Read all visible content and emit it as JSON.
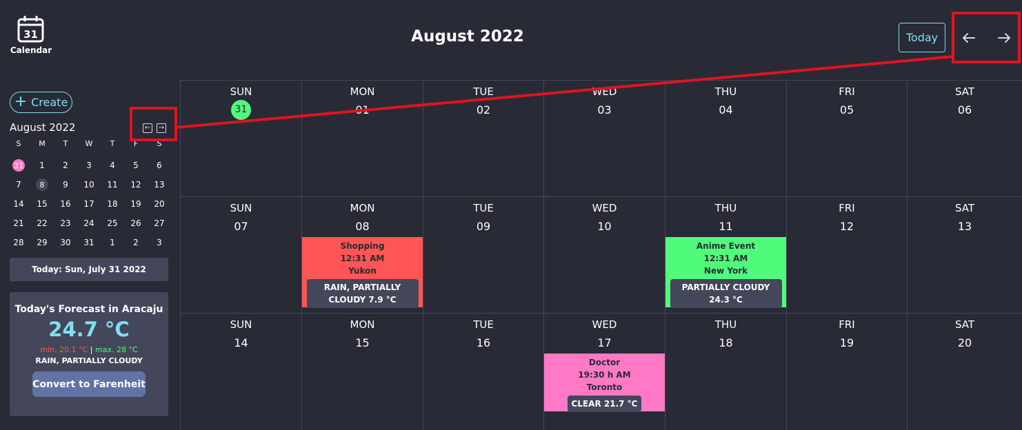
{
  "header": {
    "brand_icon_number": "31",
    "brand_label": "Calendar",
    "month_title": "August 2022",
    "today_label": "Today",
    "prev_icon": "arrow-left-icon",
    "next_icon": "arrow-right-icon"
  },
  "sidebar": {
    "create_label": "Create",
    "mini_title": "August 2022",
    "mini_headers": [
      "S",
      "M",
      "T",
      "W",
      "T",
      "F",
      "S"
    ],
    "mini_days": [
      "31",
      "1",
      "2",
      "3",
      "4",
      "5",
      "6",
      "7",
      "8",
      "9",
      "10",
      "11",
      "12",
      "13",
      "14",
      "15",
      "16",
      "17",
      "18",
      "19",
      "20",
      "21",
      "22",
      "23",
      "24",
      "25",
      "26",
      "27",
      "28",
      "29",
      "30",
      "31",
      "1",
      "2",
      "3"
    ],
    "mini_current_index": 0,
    "mini_selected_index": 8,
    "today_text": "Today: Sun, July 31 2022",
    "forecast": {
      "title": "Today's Forecast in Aracaju",
      "temp": "24.7 °C",
      "min": "min. 20.1 °C",
      "sep": "|",
      "max": "max. 28 °C",
      "condition": "RAIN, PARTIALLY CLOUDY",
      "convert_label": "Convert to Farenheit"
    }
  },
  "calendar": {
    "weeks": [
      [
        {
          "dow": "SUN",
          "num": "31",
          "current": true
        },
        {
          "dow": "MON",
          "num": "01"
        },
        {
          "dow": "TUE",
          "num": "02"
        },
        {
          "dow": "WED",
          "num": "03"
        },
        {
          "dow": "THU",
          "num": "04"
        },
        {
          "dow": "FRI",
          "num": "05"
        },
        {
          "dow": "SAT",
          "num": "06"
        }
      ],
      [
        {
          "dow": "SUN",
          "num": "07"
        },
        {
          "dow": "MON",
          "num": "08",
          "event": {
            "title": "Shopping",
            "time": "12:31 AM",
            "place": "Yukon",
            "weather": "RAIN, PARTIALLY CLOUDY 7.9 °C",
            "color": "red"
          }
        },
        {
          "dow": "TUE",
          "num": "09"
        },
        {
          "dow": "WED",
          "num": "10"
        },
        {
          "dow": "THU",
          "num": "11",
          "event": {
            "title": "Anime Event",
            "time": "12:31 AM",
            "place": "New York",
            "weather": "PARTIALLY CLOUDY 24.3 °C",
            "color": "green"
          }
        },
        {
          "dow": "FRI",
          "num": "12"
        },
        {
          "dow": "SAT",
          "num": "13"
        }
      ],
      [
        {
          "dow": "SUN",
          "num": "14"
        },
        {
          "dow": "MON",
          "num": "15"
        },
        {
          "dow": "TUE",
          "num": "16"
        },
        {
          "dow": "WED",
          "num": "17",
          "event": {
            "title": "Doctor",
            "time": "19:30 h AM",
            "place": "Toronto",
            "weather": "CLEAR 21.7 °C",
            "color": "pink"
          }
        },
        {
          "dow": "THU",
          "num": "18"
        },
        {
          "dow": "FRI",
          "num": "19"
        },
        {
          "dow": "SAT",
          "num": "20"
        }
      ]
    ]
  },
  "colors": {
    "background": "#282a36",
    "accent_cyan": "#7fe0f4",
    "event_red": "#ff5555",
    "event_green": "#50fa7b",
    "event_pink": "#ff79c6",
    "annotation_red": "#e0141e"
  }
}
